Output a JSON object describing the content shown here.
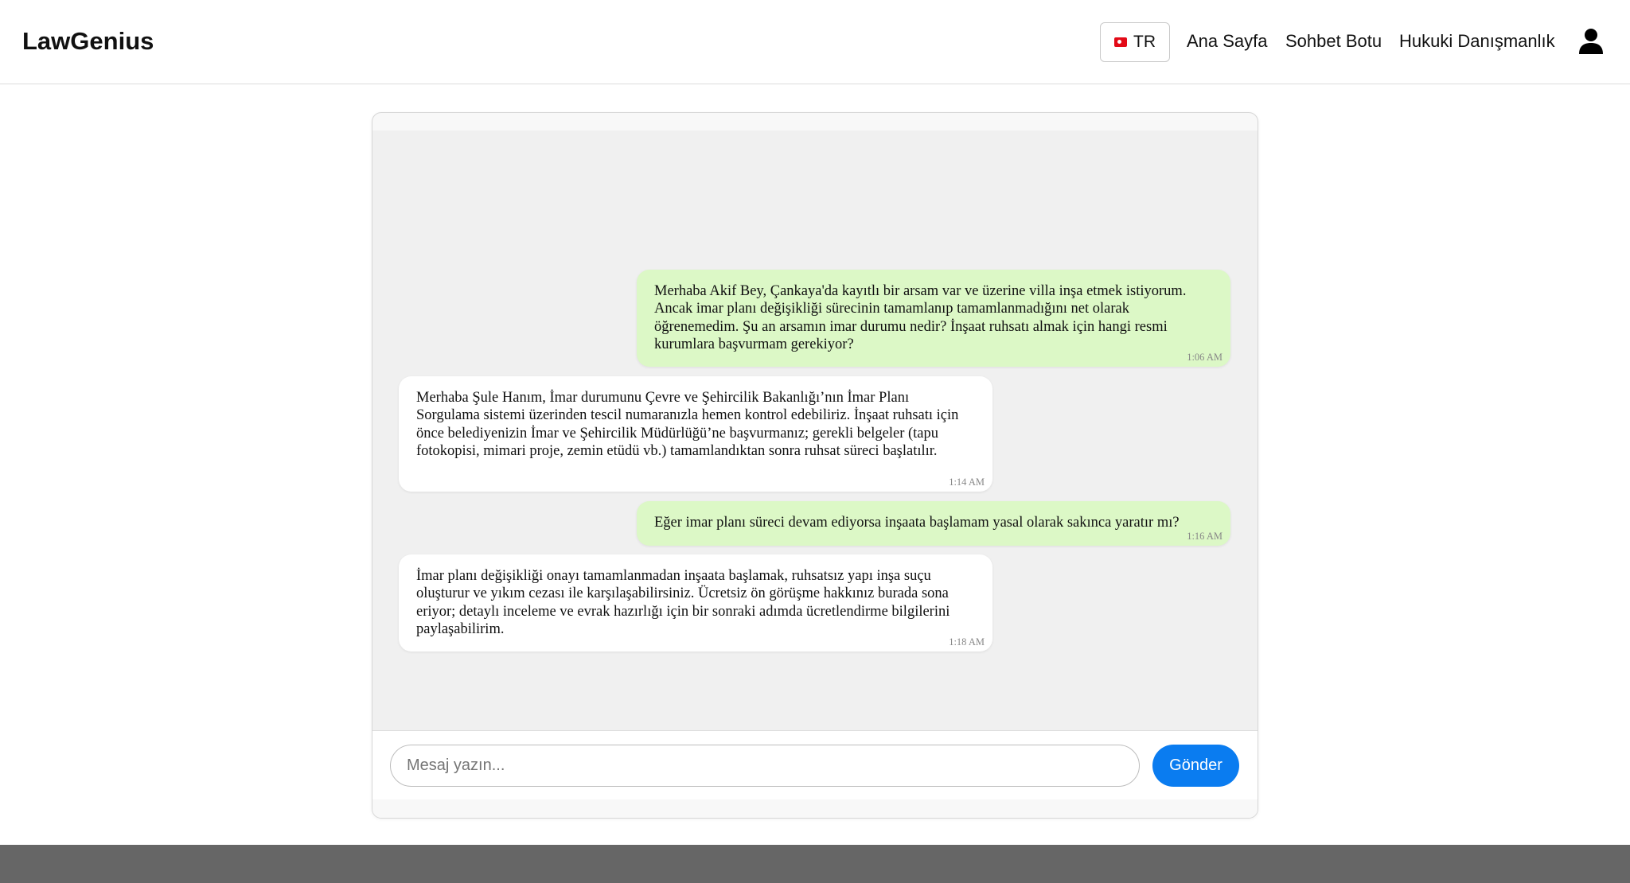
{
  "header": {
    "brand": "LawGenius",
    "language_label": "TR",
    "nav": {
      "home": "Ana Sayfa",
      "chatbot": "Sohbet Botu",
      "legal_advice": "Hukuki Danışmanlık"
    }
  },
  "messages": [
    {
      "sender": "user",
      "text": "Merhaba Akif Bey, Çankaya'da kayıtlı bir arsam var ve üzerine villa inşa etmek istiyorum. Ancak imar planı değişikliği sürecinin tamamlanıp tamamlanmadığını net olarak öğrenemedim. Şu an arsamın imar durumu nedir? İnşaat ruhsatı almak için hangi resmi kurumlara başvurmam gerekiyor?",
      "time": "1:06 AM"
    },
    {
      "sender": "bot",
      "text": "Merhaba Şule Hanım, İmar durumunu Çevre ve Şehircilik Bakanlığı’nın İmar Planı Sorgulama sistemi üzerinden tescil numaranızla hemen kontrol edebiliriz. İnşaat ruhsatı için önce belediyenizin İmar ve Şehircilik Müdürlüğü’ne başvurmanız; gerekli belgeler (tapu fotokopisi, mimari proje, zemin etüdü vb.) tamamlandıktan sonra ruhsat süreci başlatılır.",
      "time": "1:14 AM"
    },
    {
      "sender": "user",
      "text": "Eğer imar planı süreci devam ediyorsa inşaata başlamam yasal olarak sakınca yaratır mı?",
      "time": "1:16 AM"
    },
    {
      "sender": "bot",
      "text": "İmar planı değişikliği onayı tamamlanmadan inşaata başlamak, ruhsatsız yapı inşa suçu oluşturur ve yıkım cezası ile karşılaşabilirsiniz. Ücretsiz ön görüşme hakkınız burada sona eriyor; detaylı inceleme ve evrak hazırlığı için bir sonraki adımda ücretlendirme bilgilerini paylaşabilirim.",
      "time": "1:18 AM"
    }
  ],
  "composer": {
    "placeholder": "Mesaj yazın...",
    "send_label": "Gönder"
  },
  "colors": {
    "user_bubble": "#dcf8c6",
    "bot_bubble": "#ffffff",
    "send_button": "#0a7cf0",
    "footer": "#666666"
  }
}
